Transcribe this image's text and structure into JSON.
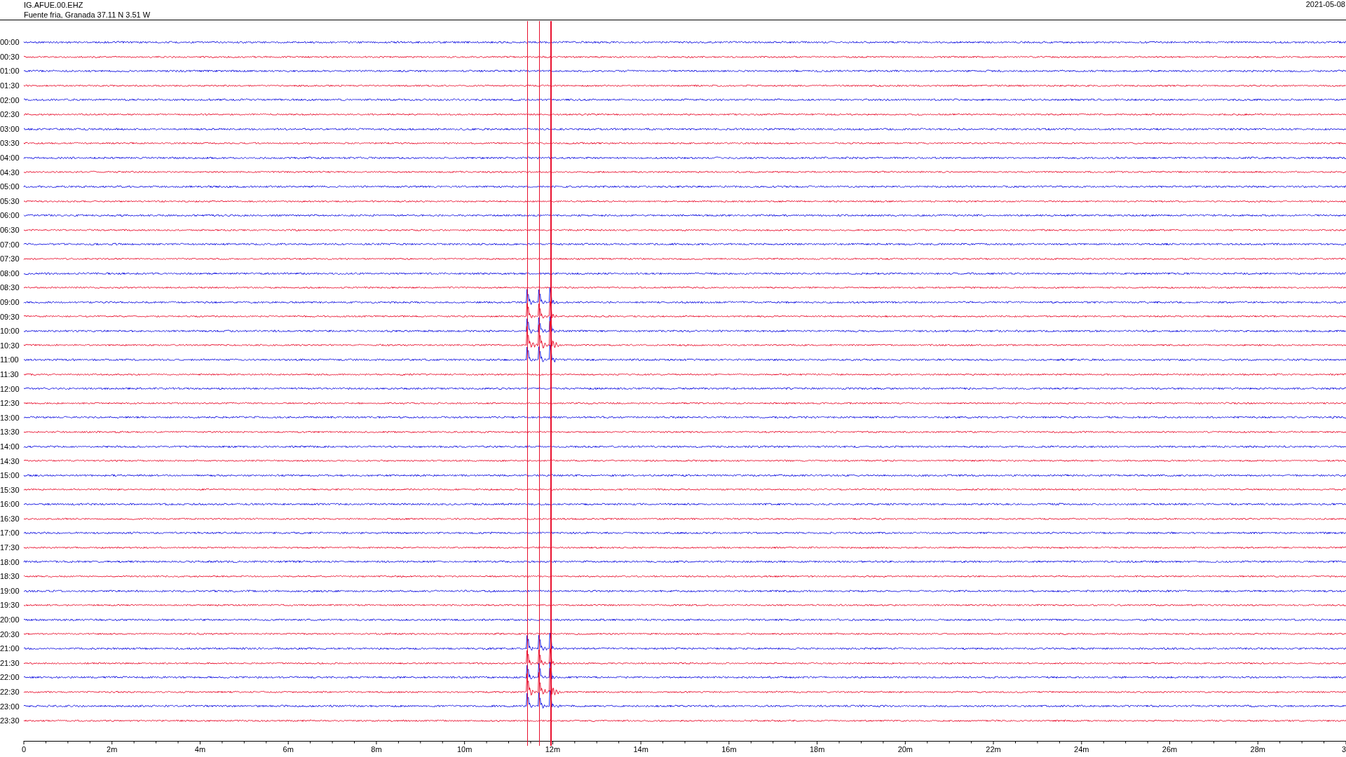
{
  "header": {
    "channel": "IG.AFUE.00.EHZ",
    "station": "Fuente fria, Granada  37.11 N 3.51 W",
    "date": "2021-05-08"
  },
  "rows": [
    {
      "label": "00:00",
      "color": "#1414e0"
    },
    {
      "label": "00:30",
      "color": "#e8102e"
    },
    {
      "label": "01:00",
      "color": "#1414e0"
    },
    {
      "label": "01:30",
      "color": "#e8102e"
    },
    {
      "label": "02:00",
      "color": "#1414e0"
    },
    {
      "label": "02:30",
      "color": "#e8102e"
    },
    {
      "label": "03:00",
      "color": "#1414e0"
    },
    {
      "label": "03:30",
      "color": "#e8102e"
    },
    {
      "label": "04:00",
      "color": "#1414e0"
    },
    {
      "label": "04:30",
      "color": "#e8102e"
    },
    {
      "label": "05:00",
      "color": "#1414e0"
    },
    {
      "label": "05:30",
      "color": "#e8102e"
    },
    {
      "label": "06:00",
      "color": "#1414e0"
    },
    {
      "label": "06:30",
      "color": "#e8102e"
    },
    {
      "label": "07:00",
      "color": "#1414e0"
    },
    {
      "label": "07:30",
      "color": "#e8102e"
    },
    {
      "label": "08:00",
      "color": "#1414e0"
    },
    {
      "label": "08:30",
      "color": "#e8102e"
    },
    {
      "label": "09:00",
      "color": "#1414e0"
    },
    {
      "label": "09:30",
      "color": "#e8102e"
    },
    {
      "label": "10:00",
      "color": "#1414e0"
    },
    {
      "label": "10:30",
      "color": "#e8102e"
    },
    {
      "label": "11:00",
      "color": "#1414e0"
    },
    {
      "label": "11:30",
      "color": "#e8102e"
    },
    {
      "label": "12:00",
      "color": "#1414e0"
    },
    {
      "label": "12:30",
      "color": "#e8102e"
    },
    {
      "label": "13:00",
      "color": "#1414e0"
    },
    {
      "label": "13:30",
      "color": "#e8102e"
    },
    {
      "label": "14:00",
      "color": "#1414e0"
    },
    {
      "label": "14:30",
      "color": "#e8102e"
    },
    {
      "label": "15:00",
      "color": "#1414e0"
    },
    {
      "label": "15:30",
      "color": "#e8102e"
    },
    {
      "label": "16:00",
      "color": "#1414e0"
    },
    {
      "label": "16:30",
      "color": "#e8102e"
    },
    {
      "label": "17:00",
      "color": "#1414e0"
    },
    {
      "label": "17:30",
      "color": "#e8102e"
    },
    {
      "label": "18:00",
      "color": "#1414e0"
    },
    {
      "label": "18:30",
      "color": "#e8102e"
    },
    {
      "label": "19:00",
      "color": "#1414e0"
    },
    {
      "label": "19:30",
      "color": "#e8102e"
    },
    {
      "label": "20:00",
      "color": "#1414e0"
    },
    {
      "label": "20:30",
      "color": "#e8102e"
    },
    {
      "label": "21:00",
      "color": "#1414e0"
    },
    {
      "label": "21:30",
      "color": "#e8102e"
    },
    {
      "label": "22:00",
      "color": "#1414e0"
    },
    {
      "label": "22:30",
      "color": "#e8102e"
    },
    {
      "label": "23:00",
      "color": "#1414e0"
    },
    {
      "label": "23:30",
      "color": "#e8102e"
    }
  ],
  "x_axis": {
    "labels": [
      "0",
      "2m",
      "4m",
      "6m",
      "8m",
      "10m",
      "12m",
      "14m",
      "16m",
      "18m",
      "20m",
      "22m",
      "24m",
      "26m",
      "28m",
      "3"
    ]
  }
}
